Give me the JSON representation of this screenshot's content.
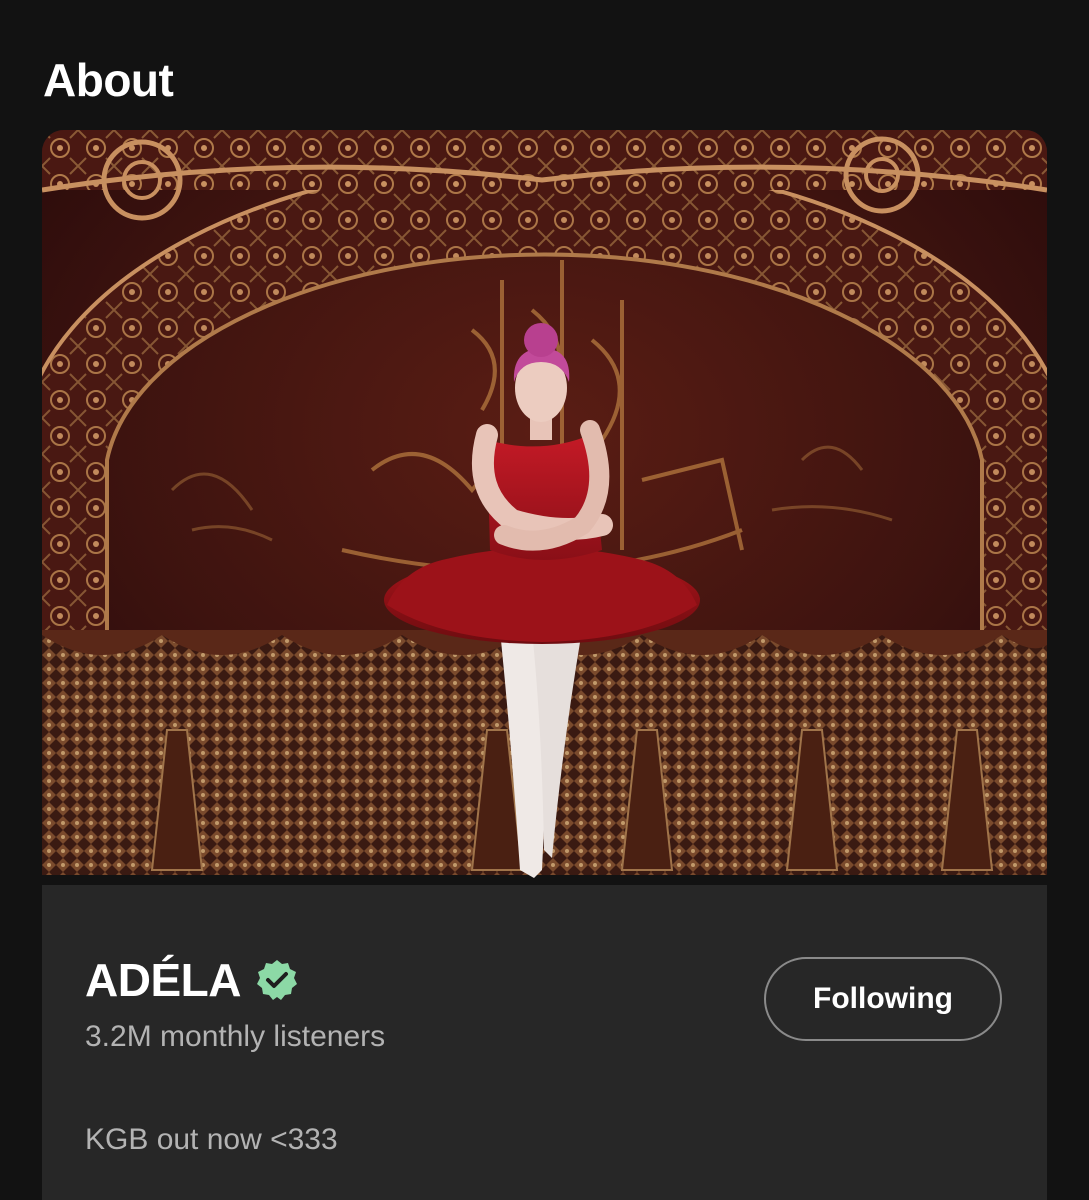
{
  "section": {
    "title": "About"
  },
  "artist": {
    "name": "ADÉLA",
    "verified": true,
    "monthly_listeners": "3.2M monthly listeners",
    "bio": "KGB out now <333",
    "image_icon": "artist-photo-ballerina"
  },
  "follow_button": {
    "label": "Following"
  },
  "colors": {
    "background": "#121212",
    "card": "#272727",
    "verified_badge": "#8cd9a6",
    "secondary_text": "#b3b3b3",
    "button_border": "#8a8a8a"
  }
}
